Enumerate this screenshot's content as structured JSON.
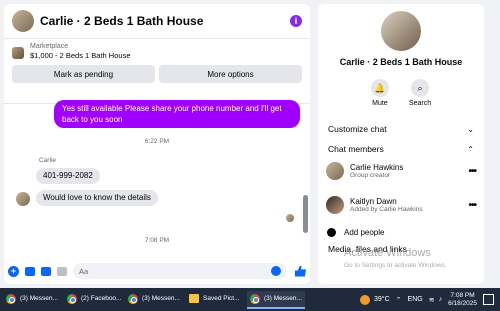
{
  "chat": {
    "title": "Carlie · 2 Beds 1 Bath House",
    "marketplace_label": "Marketplace",
    "listing": "$1,000 - 2 Beds 1 Bath House",
    "mark_pending": "Mark as pending",
    "more_options": "More options",
    "messages": [
      {
        "type": "outgoing",
        "text": "Yes still available Please share your phone number and I'll get back to you soon"
      },
      {
        "type": "time",
        "text": "6:22 PM"
      },
      {
        "type": "sender",
        "text": "Carlie"
      },
      {
        "type": "incoming",
        "text": "401-999-2082"
      },
      {
        "type": "incoming",
        "text": "Would love to know the details"
      },
      {
        "type": "time",
        "text": "7:08 PM"
      }
    ],
    "input_placeholder": "Aa"
  },
  "panel": {
    "title": "Carlie · 2 Beds 1 Bath House",
    "mute": "Mute",
    "search": "Search",
    "customize_chat": "Customize chat",
    "chat_members": "Chat members",
    "members": [
      {
        "name": "Carlie Hawkins",
        "role": "Group creator"
      },
      {
        "name": "Kaitlyn Dawn",
        "role": "Added by Carlie Hawkins"
      }
    ],
    "add_people": "Add people",
    "media": "Media, files and links",
    "watermark_title": "Activate Windows",
    "watermark_sub": "Go to Settings to activate Windows."
  },
  "taskbar": {
    "tasks": [
      {
        "label": "(3) Messen...",
        "icon": "chrome-icon"
      },
      {
        "label": "(2) Faceboo...",
        "icon": "chrome-icon"
      },
      {
        "label": "(3) Messen...",
        "icon": "chrome-icon"
      },
      {
        "label": "Saved Pict...",
        "icon": "folder-icon"
      },
      {
        "label": "(3) Messen...",
        "icon": "chrome-icon"
      }
    ],
    "temperature": "39°C",
    "language": "ENG",
    "time": "7:08 PM",
    "date": "6/18/2025"
  },
  "colors": {
    "messenger_purple": "#a000ff",
    "messenger_blue": "#0866ff"
  }
}
